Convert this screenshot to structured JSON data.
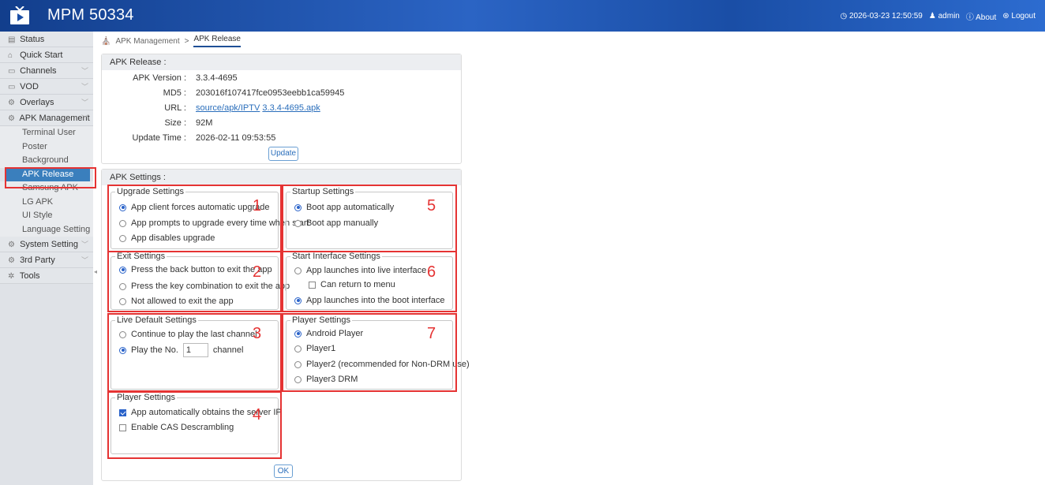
{
  "header": {
    "title": "MPM 50334",
    "datetime": "2026-03-23 12:50:59",
    "user": "admin",
    "about": "About",
    "logout": "Logout"
  },
  "sidebar": {
    "items": [
      {
        "label": "Status",
        "icon": "status-icon"
      },
      {
        "label": "Quick Start",
        "icon": "quickstart-icon"
      },
      {
        "label": "Channels",
        "icon": "monitor-icon"
      },
      {
        "label": "VOD",
        "icon": "monitor-icon"
      },
      {
        "label": "Overlays",
        "icon": "gear-icon"
      },
      {
        "label": "APK Management",
        "icon": "gear-icon"
      }
    ],
    "apk_sub": [
      "Terminal User",
      "Poster",
      "Background",
      "APK Release",
      "Samsung APK",
      "LG APK",
      "UI Style",
      "Language Setting"
    ],
    "items_after": [
      {
        "label": "System Setting",
        "icon": "gear-icon"
      },
      {
        "label": "3rd Party",
        "icon": "gear-icon"
      },
      {
        "label": "Tools",
        "icon": "tools-icon"
      }
    ]
  },
  "breadcrumb": {
    "parent": "APK Management",
    "separator": ">",
    "current": "APK Release"
  },
  "release": {
    "title": "APK Release :",
    "version_label": "APK Version :",
    "version": "3.3.4-4695",
    "md5_label": "MD5 :",
    "md5": "203016f107417fce0953eebb1ca59945",
    "url_label": "URL :",
    "url_part1": "source/apk/IPTV",
    "url_part2": "3.3.4-4695.apk",
    "size_label": "Size :",
    "size": "92M",
    "update_time_label": "Update Time :",
    "update_time": "2026-02-11 09:53:55",
    "update_button": "Update"
  },
  "settings": {
    "title": "APK Settings :",
    "upgrade": {
      "title": "Upgrade Settings",
      "options": [
        "App client forces automatic upgrade",
        "App prompts to upgrade every time when start",
        "App disables upgrade"
      ]
    },
    "exit": {
      "title": "Exit Settings",
      "options": [
        "Press the back button to exit the app",
        "Press the key combination to exit the app",
        "Not allowed to exit the app"
      ]
    },
    "live": {
      "title": "Live Default Settings",
      "opt1": "Continue to play the last channel",
      "opt2_prefix": "Play the No.",
      "channel_no": "1",
      "opt2_suffix": "channel"
    },
    "player_left": {
      "title": "Player Settings",
      "options": [
        "App automatically obtains the server IP",
        "Enable CAS Descrambling"
      ]
    },
    "startup": {
      "title": "Startup Settings",
      "options": [
        "Boot app automatically",
        "Boot app manually"
      ]
    },
    "start_interface": {
      "title": "Start Interface Settings",
      "opt1": "App launches into live interface",
      "sub": "Can return to menu",
      "opt2": "App launches into the boot interface"
    },
    "player_right": {
      "title": "Player Settings",
      "options": [
        "Android Player",
        "Player1",
        "Player2 (recommended for Non-DRM use)",
        "Player3 DRM"
      ]
    },
    "ok_button": "OK"
  },
  "annotations": [
    "1",
    "2",
    "3",
    "4",
    "5",
    "6",
    "7"
  ],
  "colors": {
    "header": "#1e4f9e",
    "accent": "#2962c9",
    "active_nav": "#3a7fbd",
    "annotation": "#e53333"
  }
}
